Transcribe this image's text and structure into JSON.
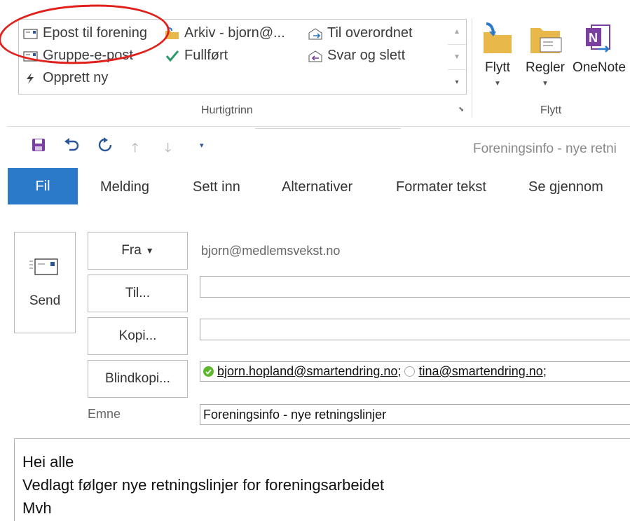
{
  "ribbon": {
    "quick_steps": [
      {
        "label": "Epost til forening",
        "icon": "envelope-icon"
      },
      {
        "label": "Gruppe-e-post",
        "icon": "envelope-icon"
      },
      {
        "label": "Opprett ny",
        "icon": "lightning-icon"
      },
      {
        "label": "Arkiv - bjorn@...",
        "icon": "archive-folder-icon"
      },
      {
        "label": "Fullført",
        "icon": "checkmark-icon"
      },
      {
        "label": "Til overordnet",
        "icon": "forward-envelope-icon"
      },
      {
        "label": "Svar og slett",
        "icon": "reply-delete-icon"
      }
    ],
    "quick_steps_group": "Hurtigtrinn",
    "move_buttons": [
      {
        "label": "Flytt",
        "icon": "move-folder-icon"
      },
      {
        "label": "Regler",
        "icon": "rules-icon"
      },
      {
        "label": "OneNote",
        "icon": "onenote-icon"
      }
    ],
    "move_group": "Flytt"
  },
  "qat": {
    "icons": [
      "save-icon",
      "undo-icon",
      "redo-icon",
      "up-arrow-icon",
      "down-arrow-icon",
      "customize-qat-icon"
    ],
    "window_title": "Foreningsinfo - nye retni"
  },
  "tabs": [
    "Fil",
    "Melding",
    "Sett inn",
    "Alternativer",
    "Formater tekst",
    "Se gjennom"
  ],
  "compose": {
    "send_label": "Send",
    "from_label": "Fra",
    "from_value": "bjorn@medlemsvekst.no",
    "to_label": "Til...",
    "to_value": "",
    "cc_label": "Kopi...",
    "cc_value": "",
    "bcc_label": "Blindkopi...",
    "bcc_recipients": [
      {
        "address": "bjorn.hopland@smartendring.no",
        "status": "online"
      },
      {
        "address": "tina@smartendring.no",
        "status": "unknown"
      }
    ],
    "subject_label": "Emne",
    "subject_value": "Foreningsinfo - nye retningslinjer",
    "body_lines": [
      "Hei alle",
      "Vedlagt følger nye retningslinjer for foreningsarbeidet",
      "Mvh"
    ]
  },
  "colors": {
    "accent": "#2b79c9",
    "annotation": "#e0201b",
    "onenote": "#7b3fa0",
    "presence_online": "#5cb82b"
  }
}
